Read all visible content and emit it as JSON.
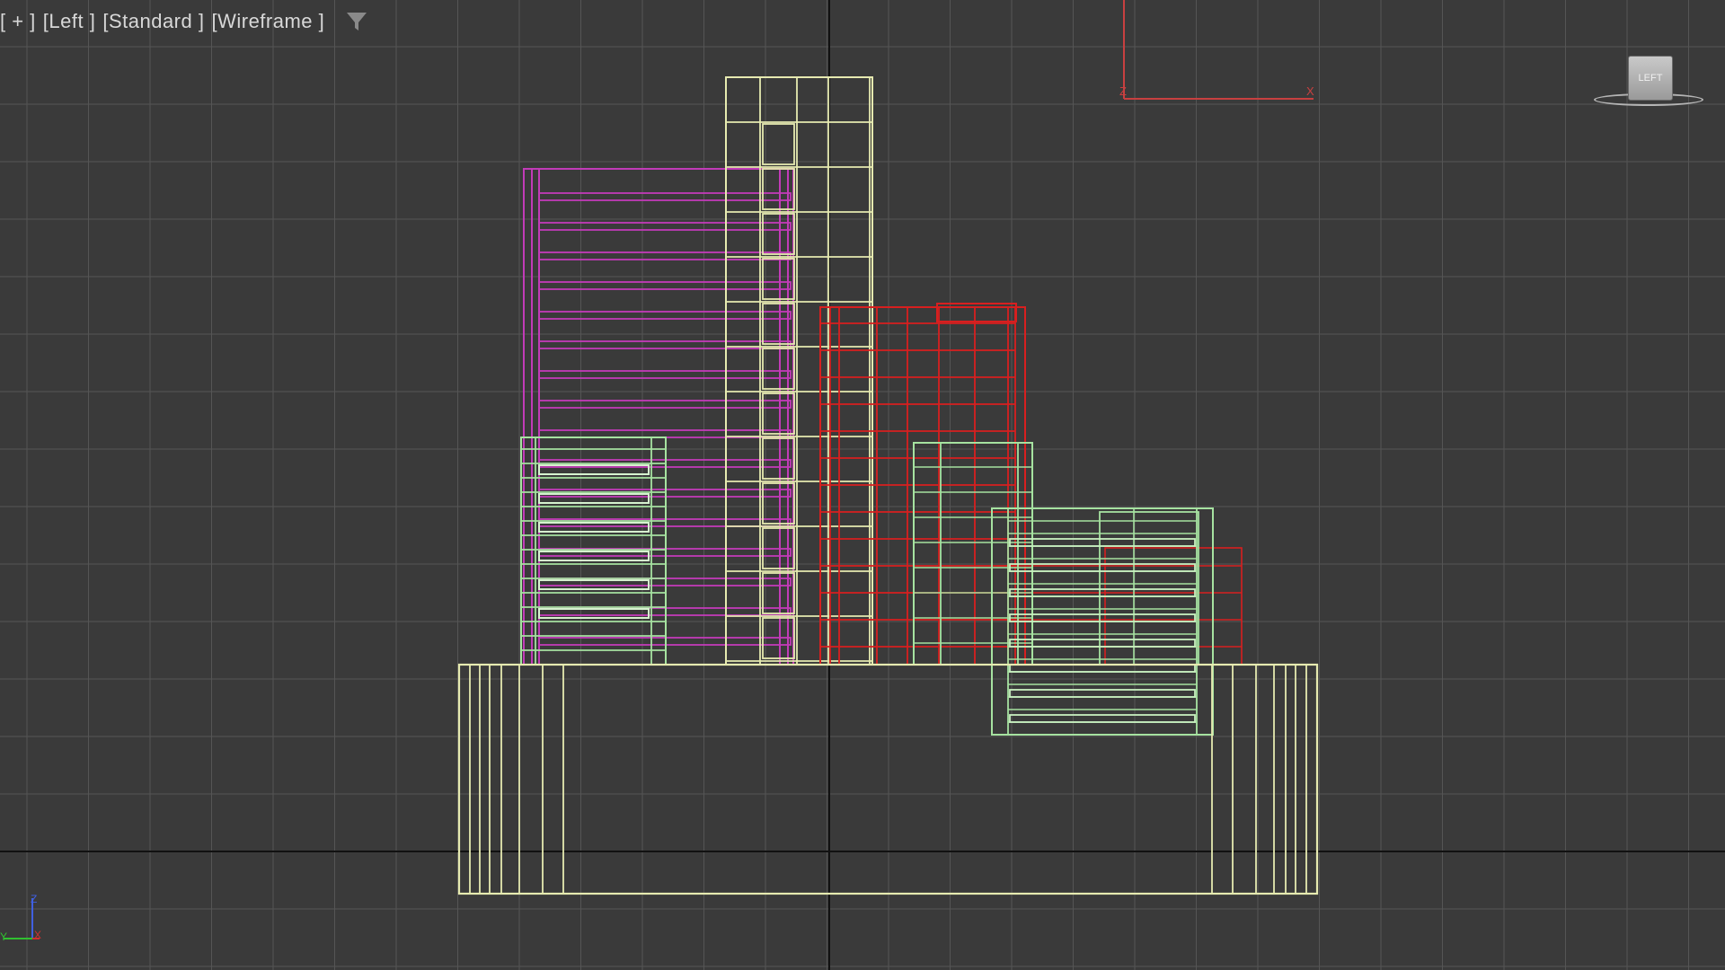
{
  "viewport": {
    "menu": {
      "plus": "[ + ]",
      "view": "[Left ]",
      "shading": "[Standard ]",
      "mode": "[Wireframe ]"
    },
    "filter_icon": "filter-funnel-icon",
    "viewcube_label": "LEFT",
    "axis_gizmo": {
      "horizontal": "X",
      "vertical": "Z"
    },
    "corner_axis": {
      "z": "Z",
      "y": "Y",
      "x": "X"
    }
  },
  "colors": {
    "background": "#3a3a3a",
    "grid": "#555555",
    "axis_lines": "#111111",
    "wire_yellow": "#e6eab0",
    "wire_magenta": "#c23bb8",
    "wire_red": "#d81f1f",
    "wire_green": "#a6e2a0",
    "gizmo_red": "#c84040"
  }
}
